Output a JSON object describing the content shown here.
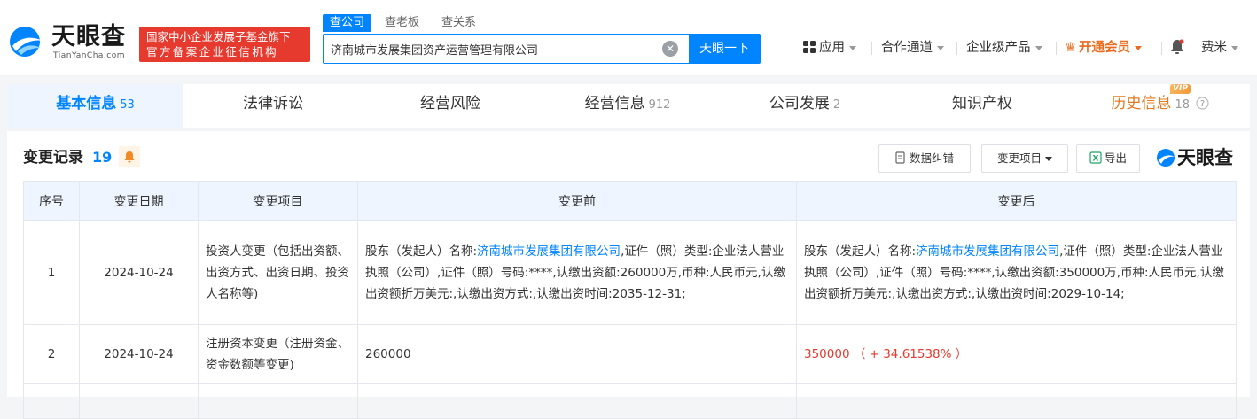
{
  "brand": {
    "name_cn": "天眼查",
    "name_en": "TianYanCha.com",
    "slogan_line1": "国家中小企业发展子基金旗下",
    "slogan_line2": "官方备案企业征信机构"
  },
  "search": {
    "tabs": [
      "查公司",
      "查老板",
      "查关系"
    ],
    "active_tab": 0,
    "value": "济南城市发展集团资产运营管理有限公司",
    "button": "天眼一下"
  },
  "nav": {
    "apps": "应用",
    "cooperation": "合作通道",
    "enterprise": "企业级产品",
    "vip": "开通会员",
    "user": "费米"
  },
  "tabs": [
    {
      "label": "基本信息",
      "count": "53"
    },
    {
      "label": "法律诉讼",
      "count": ""
    },
    {
      "label": "经营风险",
      "count": ""
    },
    {
      "label": "经营信息",
      "count": "912"
    },
    {
      "label": "公司发展",
      "count": "2"
    },
    {
      "label": "知识产权",
      "count": ""
    },
    {
      "label": "历史信息",
      "count": "18",
      "badge": "VIP"
    }
  ],
  "section": {
    "title": "变更记录",
    "count": "19",
    "btn_correct": "数据纠错",
    "btn_items": "变更项目",
    "btn_export": "导出",
    "watermark": "天眼查"
  },
  "table": {
    "headers": [
      "序号",
      "变更日期",
      "变更项目",
      "变更前",
      "变更后"
    ],
    "rows": [
      {
        "no": "1",
        "date": "2024-10-24",
        "item": "投资人变更（包括出资额、出资方式、出资日期、投资人名称等)",
        "before_prefix": "股东（发起人）名称:",
        "before_link": "济南城市发展集团有限公司",
        "before_rest": ",证件（照）类型:企业法人营业执照（公司）,证件（照）号码:****,认缴出资额:260000万,币种:人民币元,认缴出资额折万美元:,认缴出资方式:,认缴出资时间:2035-12-31;",
        "after_prefix": "股东（发起人）名称:",
        "after_link": "济南城市发展集团有限公司",
        "after_rest": ",证件（照）类型:企业法人营业执照（公司）,证件（照）号码:****,认缴出资额:350000万,币种:人民币元,认缴出资额折万美元:,认缴出资方式:,认缴出资时间:2029-10-14;"
      },
      {
        "no": "2",
        "date": "2024-10-24",
        "item": "注册资本变更（注册资金、资金数额等变更)",
        "before": "260000",
        "after": "350000 （ + 34.61538% ）"
      }
    ]
  },
  "colors": {
    "primary": "#0084ff",
    "accent_red": "#e63a2f",
    "vip_orange": "#ea6c1f"
  }
}
